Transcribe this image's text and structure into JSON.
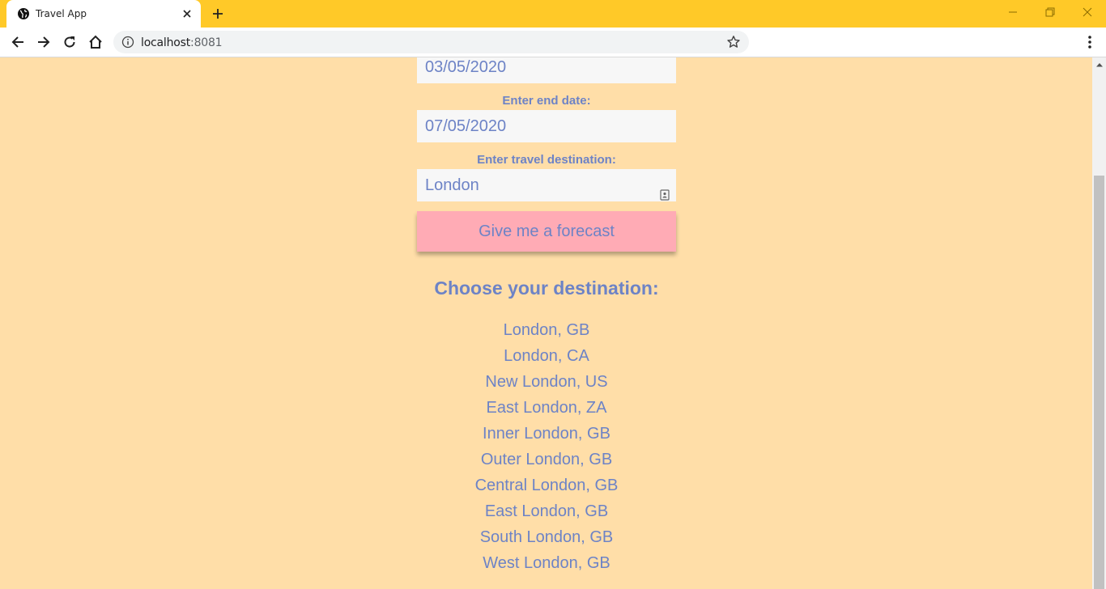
{
  "browser": {
    "tab_title": "Travel App",
    "url_host": "localhost",
    "url_port": ":8081"
  },
  "form": {
    "start_date_value": "03/05/2020",
    "end_date_label": "Enter end date:",
    "end_date_value": "07/05/2020",
    "destination_label": "Enter travel destination:",
    "destination_value": "London",
    "submit_label": "Give me a forecast"
  },
  "destinations": {
    "heading": "Choose your destination:",
    "items": [
      "London, GB",
      "London, CA",
      "New London, US",
      "East London, ZA",
      "Inner London, GB",
      "Outer London, GB",
      "Central London, GB",
      "East London, GB",
      "South London, GB",
      "West London, GB"
    ]
  },
  "colors": {
    "tab_strip": "#ffc928",
    "page_background": "#ffdea8",
    "text_accent": "#6d83c6",
    "button_background": "#ffabb5",
    "field_background": "#f7f7f7"
  }
}
